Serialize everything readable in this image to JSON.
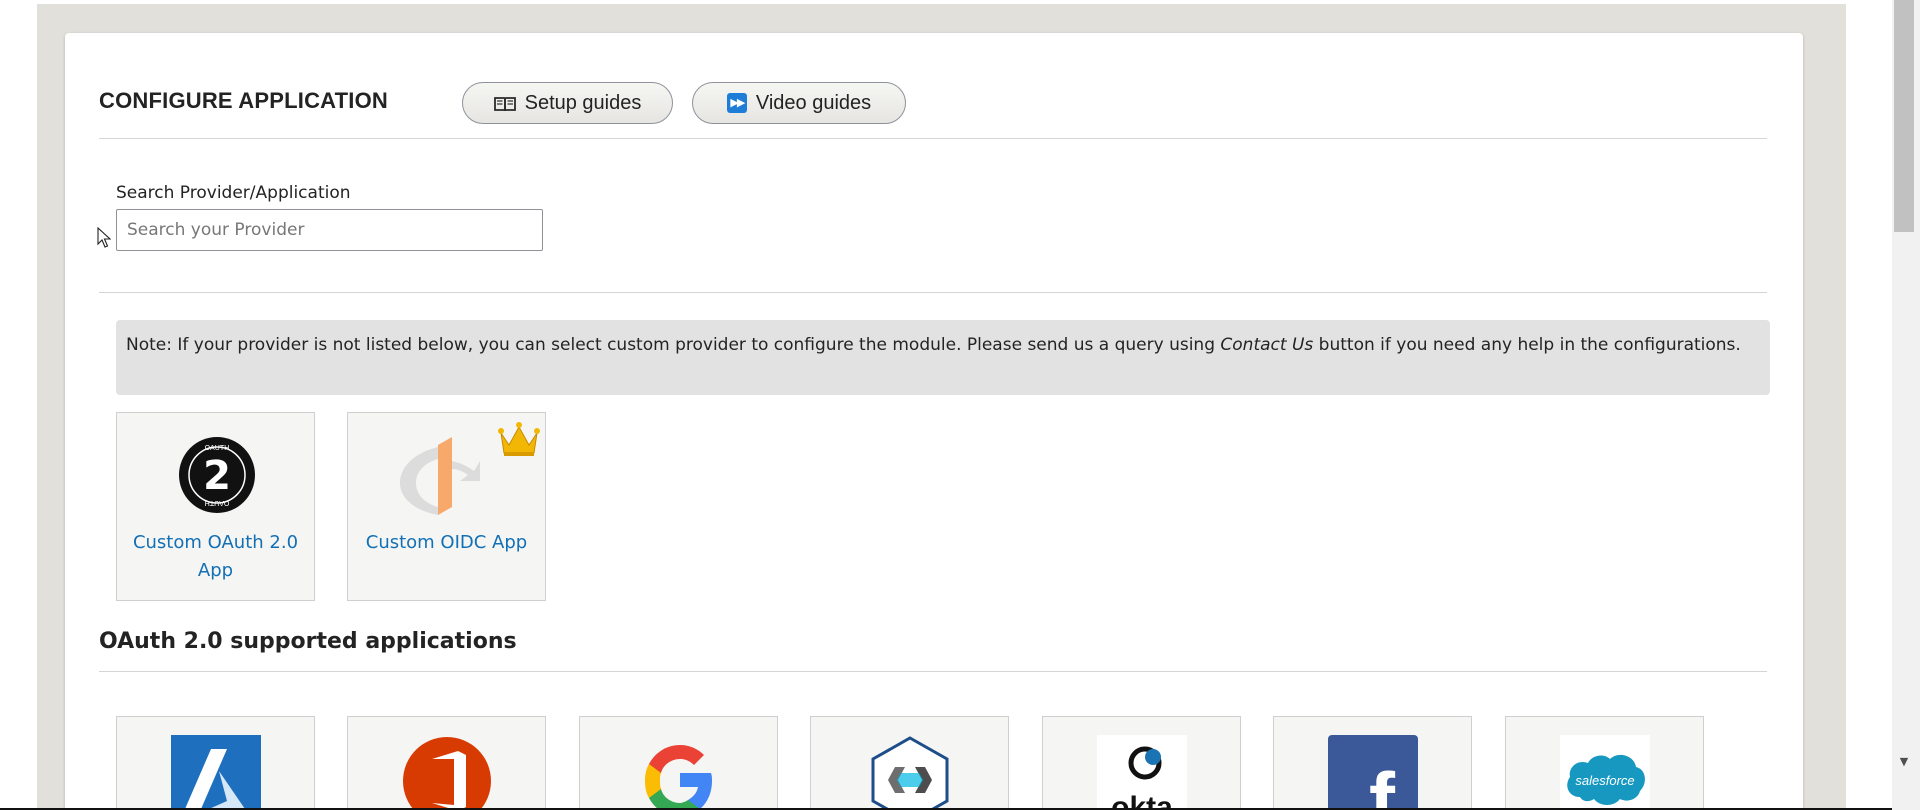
{
  "header": {
    "title": "CONFIGURE APPLICATION",
    "setup_guides_label": "Setup guides",
    "video_guides_label": "Video guides"
  },
  "search": {
    "label": "Search Provider/Application",
    "placeholder": "Search your Provider",
    "value": ""
  },
  "note": {
    "before": "Note: If your provider is not listed below, you can select custom provider to configure the module. Please send us a query using ",
    "emphasis": "Contact Us",
    "after": " button if you need any help in the configurations."
  },
  "custom_apps": [
    {
      "label": "Custom OAuth 2.0 App",
      "icon": "oauth2-logo-icon",
      "premium": false
    },
    {
      "label": "Custom OIDC App",
      "icon": "openid-logo-icon",
      "premium": true
    }
  ],
  "supported_section": {
    "title": "OAuth 2.0 supported applications",
    "apps": [
      {
        "icon": "azure-logo-icon",
        "color": "#1f6fbf"
      },
      {
        "icon": "office365-logo-icon",
        "color": "#d83b01"
      },
      {
        "icon": "google-logo-icon",
        "color": "#4285f4"
      },
      {
        "icon": "keycloak-logo-icon",
        "color": "#4d4d4d"
      },
      {
        "icon": "okta-logo-icon",
        "color": "#111111",
        "logo_text": "okta"
      },
      {
        "icon": "facebook-logo-icon",
        "color": "#3b5998",
        "logo_text": "f"
      },
      {
        "icon": "salesforce-logo-icon",
        "color": "#1798c1",
        "logo_text": "salesforce"
      }
    ]
  },
  "colors": {
    "link": "#1370b5",
    "premium_crown": "#f2b705",
    "video_icon": "#1f7dd8"
  }
}
